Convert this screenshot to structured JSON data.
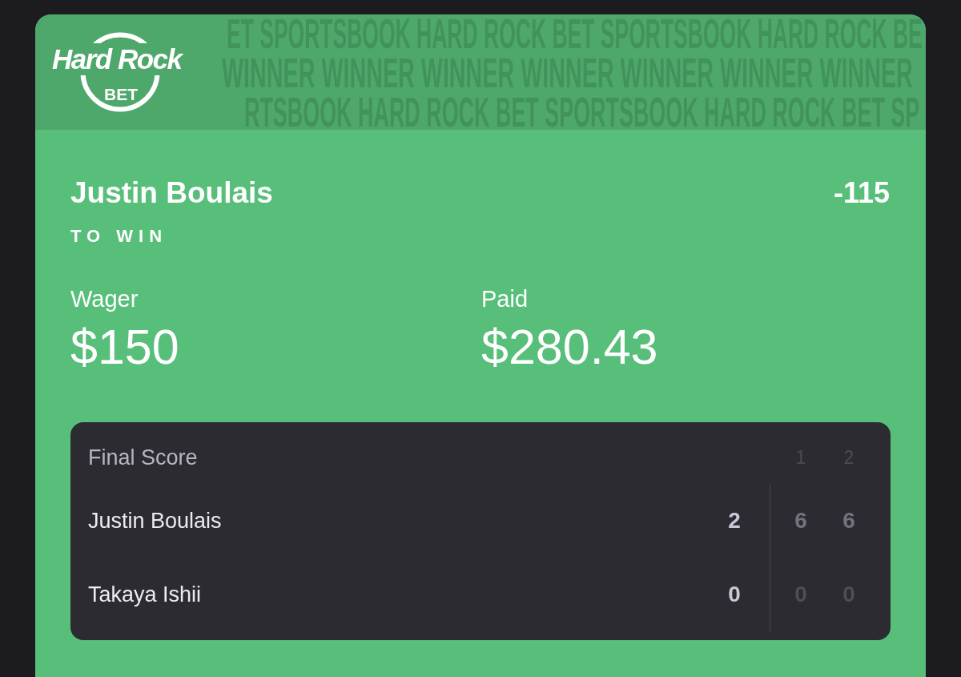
{
  "logo": {
    "wordmark": "Hard Rock",
    "subtitle": "BET"
  },
  "banner_pattern": [
    "ET SPORTSBOOK HARD ROCK BET SPORTSBOOK HARD ROCK BE",
    "WINNER WINNER WINNER WINNER WINNER WINNER WINNER",
    "RTSBOOK HARD ROCK BET SPORTSBOOK HARD ROCK BET SP"
  ],
  "bet": {
    "selection": "Justin Boulais",
    "odds": "-115",
    "market": "TO WIN"
  },
  "amounts": [
    {
      "label": "Wager",
      "value": "$150"
    },
    {
      "label": "Paid",
      "value": "$280.43"
    }
  ],
  "scoreboard": {
    "title": "Final Score",
    "periods": [
      "1",
      "2"
    ],
    "rows": [
      {
        "name": "Justin Boulais",
        "total": "2",
        "sets": [
          {
            "score": "6",
            "won": true
          },
          {
            "score": "6",
            "won": true
          }
        ]
      },
      {
        "name": "Takaya Ishii",
        "total": "0",
        "sets": [
          {
            "score": "0",
            "won": false
          },
          {
            "score": "0",
            "won": false
          }
        ]
      }
    ]
  }
}
